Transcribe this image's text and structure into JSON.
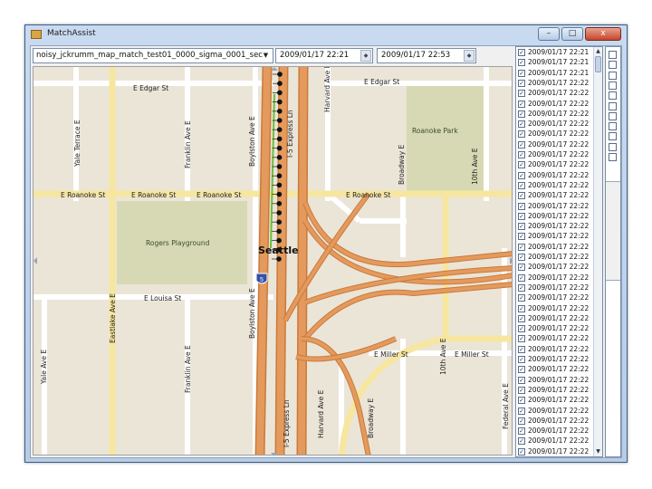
{
  "window": {
    "title": "MatchAssist",
    "min_glyph": "–",
    "max_glyph": "□",
    "close_glyph": "x"
  },
  "toolbar": {
    "trace_combo_value": "noisy_jckrumm_map_match_test01_0000_sigma_0001_sec",
    "combo_arrow_glyph": "▼",
    "start_time": "2009/01/17 22:21",
    "end_time": "2009/01/17 22:53",
    "spin_glyph": "◆"
  },
  "map": {
    "streets": {
      "edgar": "E Edgar St",
      "edgar2": "E Edgar St",
      "roanoke1": "E Roanoke St",
      "roanoke2": "E Roanoke St",
      "roanoke3": "E Roanoke St",
      "roanoke4": "E Roanoke St",
      "louisa": "E Louisa St",
      "miller1": "E Miller St",
      "miller2": "E Miller St",
      "yale_terrace": "Yale Terrace E",
      "franklin1": "Franklin Ave E",
      "franklin2": "Franklin Ave E",
      "boylston1": "Boylston Ave E",
      "boylston2": "Boylston Ave E",
      "harvard1": "Harvard Ave E",
      "harvard2": "Harvard Ave E",
      "broadway1": "Broadway E",
      "broadway2": "Broadway E",
      "tenth1": "10th Ave E",
      "tenth2": "10th Ave E",
      "eastlake": "Eastlake Ave E",
      "yale": "Yale Ave E",
      "federal": "Federal Ave E",
      "i5exp1": "I-5 Express Ln",
      "i5exp2": "I-5 Express Ln"
    },
    "parks": {
      "roanoke_park": "Roanoke Park",
      "rogers": "Rogers Playground"
    },
    "city": "Seattle",
    "shield": "5",
    "colors": {
      "highway": "#e49a5c",
      "highway_edge": "#c97a3c",
      "arterial": "#f6e6a0",
      "park": "#d7d9b4",
      "route": "#6bbf3a",
      "points": "#111111"
    }
  },
  "list": {
    "rows": [
      {
        "checked": true,
        "text": "2009/01/17 22:21"
      },
      {
        "checked": true,
        "text": "2009/01/17 22:21"
      },
      {
        "checked": true,
        "text": "2009/01/17 22:21"
      },
      {
        "checked": true,
        "text": "2009/01/17 22:22"
      },
      {
        "checked": true,
        "text": "2009/01/17 22:22"
      },
      {
        "checked": true,
        "text": "2009/01/17 22:22"
      },
      {
        "checked": true,
        "text": "2009/01/17 22:22"
      },
      {
        "checked": true,
        "text": "2009/01/17 22:22"
      },
      {
        "checked": true,
        "text": "2009/01/17 22:22"
      },
      {
        "checked": true,
        "text": "2009/01/17 22:22"
      },
      {
        "checked": true,
        "text": "2009/01/17 22:22"
      },
      {
        "checked": true,
        "text": "2009/01/17 22:22"
      },
      {
        "checked": true,
        "text": "2009/01/17 22:22"
      },
      {
        "checked": true,
        "text": "2009/01/17 22:22"
      },
      {
        "checked": true,
        "text": "2009/01/17 22:22"
      },
      {
        "checked": true,
        "text": "2009/01/17 22:22"
      },
      {
        "checked": true,
        "text": "2009/01/17 22:22"
      },
      {
        "checked": true,
        "text": "2009/01/17 22:22"
      },
      {
        "checked": true,
        "text": "2009/01/17 22:22"
      },
      {
        "checked": true,
        "text": "2009/01/17 22:22"
      },
      {
        "checked": true,
        "text": "2009/01/17 22:22"
      },
      {
        "checked": true,
        "text": "2009/01/17 22:22"
      },
      {
        "checked": true,
        "text": "2009/01/17 22:22"
      },
      {
        "checked": true,
        "text": "2009/01/17 22:22"
      },
      {
        "checked": true,
        "text": "2009/01/17 22:22"
      },
      {
        "checked": true,
        "text": "2009/01/17 22:22"
      },
      {
        "checked": true,
        "text": "2009/01/17 22:22"
      },
      {
        "checked": true,
        "text": "2009/01/17 22:22"
      },
      {
        "checked": true,
        "text": "2009/01/17 22:22"
      },
      {
        "checked": true,
        "text": "2009/01/17 22:22"
      },
      {
        "checked": true,
        "text": "2009/01/17 22:22"
      },
      {
        "checked": true,
        "text": "2009/01/17 22:22"
      },
      {
        "checked": true,
        "text": "2009/01/17 22:22"
      },
      {
        "checked": true,
        "text": "2009/01/17 22:22"
      },
      {
        "checked": true,
        "text": "2009/01/17 22:22"
      },
      {
        "checked": true,
        "text": "2009/01/17 22:22"
      },
      {
        "checked": true,
        "text": "2009/01/17 22:22"
      },
      {
        "checked": true,
        "text": "2009/01/17 22:22"
      },
      {
        "checked": true,
        "text": "2009/01/17 22:22"
      },
      {
        "checked": true,
        "text": "2009/01/17 22:22"
      }
    ],
    "scroll_up_glyph": "▲",
    "scroll_down_glyph": "▼"
  }
}
